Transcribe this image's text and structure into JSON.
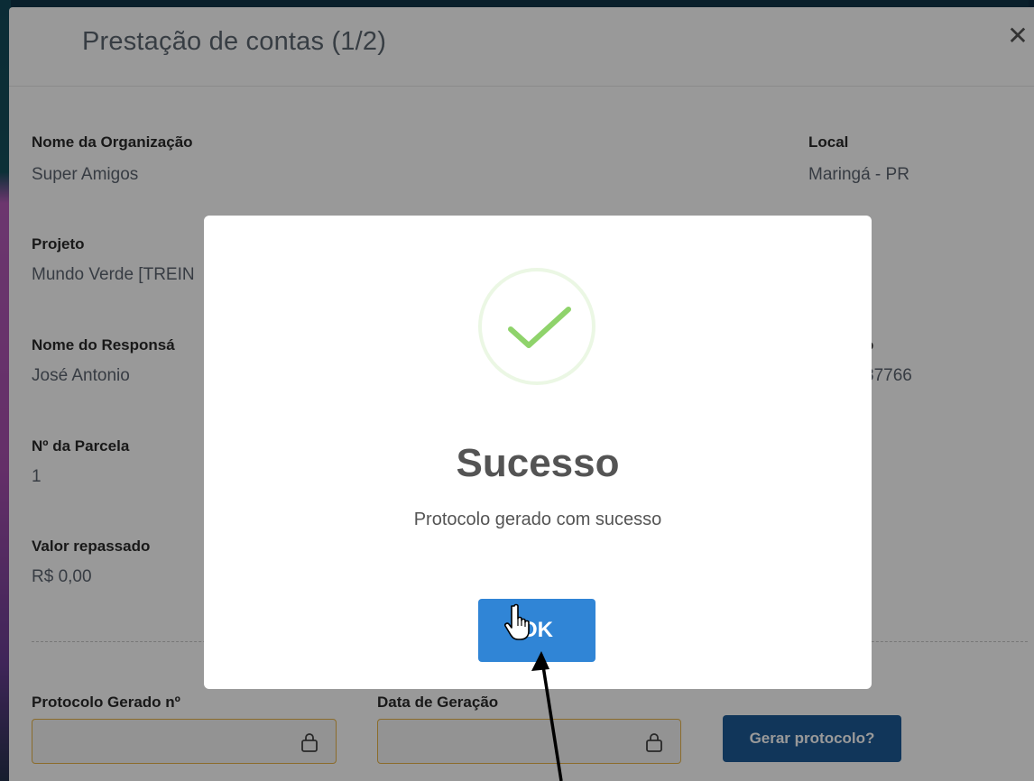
{
  "dialog": {
    "title": "Prestação de contas (1/2)",
    "close_symbol": "✕"
  },
  "fields": {
    "org_label": "Nome da Organização",
    "org_value": "Super Amigos",
    "local_label": "Local",
    "local_value": "Maringá - PR",
    "projeto_label": "Projeto",
    "projeto_value": "Mundo Verde [TREIN",
    "responsavel_label": "Nome do Responsá",
    "responsavel_value": "José Antonio",
    "right_partial_label": "o",
    "right_partial_value": "87766",
    "parcela_label": "Nº da Parcela",
    "parcela_value": "1",
    "valor_label": "Valor repassado",
    "valor_value": "R$ 0,00"
  },
  "protocol": {
    "protocolo_label": "Protocolo Gerado nº",
    "protocolo_value": "",
    "data_label": "Data de Geração",
    "data_value": "",
    "generate_button": "Gerar protocolo?"
  },
  "modal": {
    "icon": "success-check-icon",
    "title": "Sucesso",
    "message": "Protocolo gerado com sucesso",
    "ok_button": "OK"
  },
  "colors": {
    "ok_button": "#3085d6",
    "generate_button": "#1d5b97",
    "success_check": "#8fd36b",
    "input_border": "#e8b548"
  }
}
